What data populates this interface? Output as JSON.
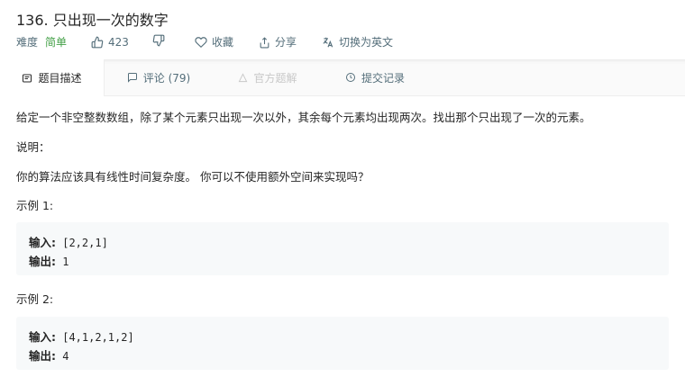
{
  "problem": {
    "title": "136. 只出现一次的数字",
    "difficulty_label": "难度",
    "difficulty_value": "简单",
    "likes": "423",
    "favorite_label": "收藏",
    "share_label": "分享",
    "switch_lang_label": "切换为英文"
  },
  "tabs": [
    {
      "label": "题目描述",
      "icon": "description-icon",
      "active": true
    },
    {
      "label": "评论 (79)",
      "icon": "comment-icon",
      "active": false
    },
    {
      "label": "官方题解",
      "icon": "solution-icon",
      "active": false,
      "disabled": true
    },
    {
      "label": "提交记录",
      "icon": "clock-icon",
      "active": false
    }
  ],
  "description": {
    "paragraph1": "给定一个非空整数数组，除了某个元素只出现一次以外，其余每个元素均出现两次。找出那个只出现了一次的元素。",
    "note_label": "说明：",
    "paragraph2": "你的算法应该具有线性时间复杂度。 你可以不使用额外空间来实现吗？"
  },
  "examples": [
    {
      "label": "示例 1:",
      "input_key": "输入:",
      "input_value": "[2,2,1]",
      "output_key": "输出:",
      "output_value": "1"
    },
    {
      "label": "示例 2:",
      "input_key": "输入:",
      "input_value": "[4,1,2,1,2]",
      "output_key": "输出:",
      "output_value": "4"
    }
  ],
  "colors": {
    "easy": "#43a047",
    "muted": "#546e7a",
    "code_bg": "#f7f9fa",
    "tab_bar_bg": "#fafafa"
  }
}
